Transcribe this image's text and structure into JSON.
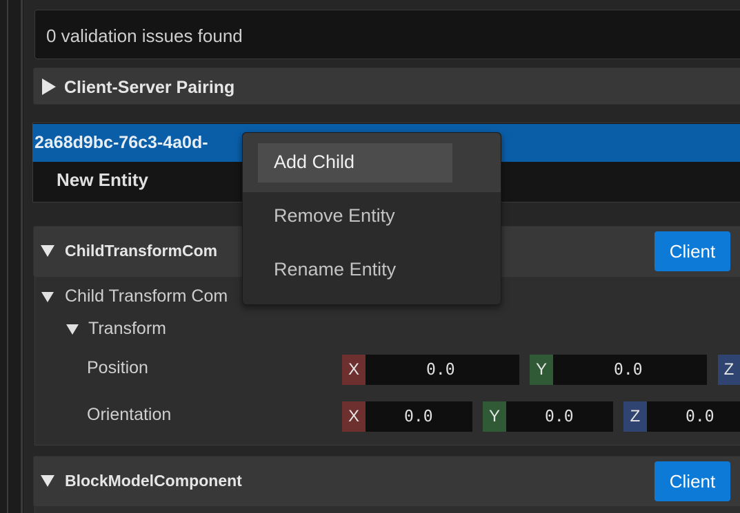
{
  "validation": {
    "text": "0 validation issues found"
  },
  "pairing": {
    "title": "Client-Server Pairing"
  },
  "entity": {
    "selected_id": "2a68d9bc-76c3-4a0d-",
    "name": "New Entity"
  },
  "context_menu": {
    "items": [
      {
        "label": "Add Child",
        "highlighted": true
      },
      {
        "label": "Remove Entity",
        "highlighted": false
      },
      {
        "label": "Rename Entity",
        "highlighted": false
      }
    ]
  },
  "child_transform": {
    "title": "ChildTransformCom",
    "client_label": "Client",
    "property_label": "Child Transform Com",
    "transform_label": "Transform",
    "position": {
      "label": "Position",
      "x": "0.0",
      "y": "0.0",
      "z_axis": "Z"
    },
    "orientation": {
      "label": "Orientation",
      "x": "0.0",
      "y": "0.0",
      "z": "0.0"
    }
  },
  "block_model": {
    "title": "BlockModelComponent",
    "client_label": "Client"
  },
  "axis_labels": {
    "x": "X",
    "y": "Y",
    "z": "Z"
  },
  "colors": {
    "selection": "#0a5ea8",
    "client_button": "#0d7ad8",
    "axis_x": "#6e2f2f",
    "axis_y": "#2f5a35",
    "axis_z": "#2f4470"
  }
}
